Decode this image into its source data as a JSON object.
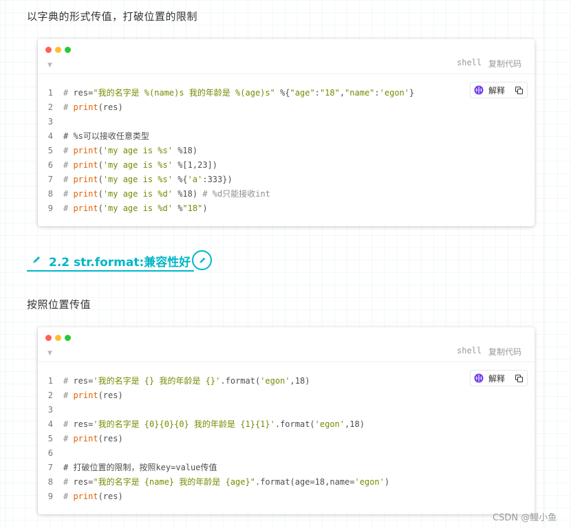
{
  "intro_paragraph": "以字典的形式传值，打破位置的限制",
  "code_blocks": [
    {
      "language": "shell",
      "copy_label": "复制代码",
      "explain_label": "解释",
      "lines": [
        {
          "n": "1",
          "tokens": [
            {
              "t": "c",
              "v": "# "
            },
            {
              "t": "p",
              "v": "res="
            },
            {
              "t": "s",
              "v": "\"我的名字是 %(name)s 我的年龄是 %(age)s\""
            },
            {
              "t": "p",
              "v": " %{"
            },
            {
              "t": "s",
              "v": "\"age\""
            },
            {
              "t": "p",
              "v": ":"
            },
            {
              "t": "s",
              "v": "\"18\""
            },
            {
              "t": "p",
              "v": ","
            },
            {
              "t": "s",
              "v": "\"name\""
            },
            {
              "t": "p",
              "v": ":"
            },
            {
              "t": "s",
              "v": "'egon'"
            },
            {
              "t": "p",
              "v": "}"
            }
          ]
        },
        {
          "n": "2",
          "tokens": [
            {
              "t": "c",
              "v": "# "
            },
            {
              "t": "h",
              "v": "print"
            },
            {
              "t": "p",
              "v": "(res)"
            }
          ]
        },
        {
          "n": "3",
          "tokens": []
        },
        {
          "n": "4",
          "tokens": [
            {
              "t": "t",
              "v": "# %s可以接收任意类型"
            }
          ]
        },
        {
          "n": "5",
          "tokens": [
            {
              "t": "c",
              "v": "# "
            },
            {
              "t": "h",
              "v": "print"
            },
            {
              "t": "p",
              "v": "("
            },
            {
              "t": "s",
              "v": "'my age is %s'"
            },
            {
              "t": "p",
              "v": " %18)"
            }
          ]
        },
        {
          "n": "6",
          "tokens": [
            {
              "t": "c",
              "v": "# "
            },
            {
              "t": "h",
              "v": "print"
            },
            {
              "t": "p",
              "v": "("
            },
            {
              "t": "s",
              "v": "'my age is %s'"
            },
            {
              "t": "p",
              "v": " %[1,23])"
            }
          ]
        },
        {
          "n": "7",
          "tokens": [
            {
              "t": "c",
              "v": "# "
            },
            {
              "t": "h",
              "v": "print"
            },
            {
              "t": "p",
              "v": "("
            },
            {
              "t": "s",
              "v": "'my age is %s'"
            },
            {
              "t": "p",
              "v": " %{"
            },
            {
              "t": "s",
              "v": "'a'"
            },
            {
              "t": "p",
              "v": ":333})"
            }
          ]
        },
        {
          "n": "8",
          "tokens": [
            {
              "t": "c",
              "v": "# "
            },
            {
              "t": "h",
              "v": "print"
            },
            {
              "t": "p",
              "v": "("
            },
            {
              "t": "s",
              "v": "'my age is %d'"
            },
            {
              "t": "p",
              "v": " %18) "
            },
            {
              "t": "c",
              "v": "# %d只能接收int"
            }
          ]
        },
        {
          "n": "9",
          "tokens": [
            {
              "t": "c",
              "v": "# "
            },
            {
              "t": "h",
              "v": "print"
            },
            {
              "t": "p",
              "v": "("
            },
            {
              "t": "s",
              "v": "'my age is %d'"
            },
            {
              "t": "p",
              "v": " %"
            },
            {
              "t": "s",
              "v": "\"18\""
            },
            {
              "t": "p",
              "v": ")"
            }
          ]
        }
      ]
    },
    {
      "language": "shell",
      "copy_label": "复制代码",
      "explain_label": "解释",
      "lines": [
        {
          "n": "1",
          "tokens": [
            {
              "t": "c",
              "v": "# "
            },
            {
              "t": "p",
              "v": "res="
            },
            {
              "t": "s",
              "v": "'我的名字是 {} 我的年龄是 {}'"
            },
            {
              "t": "p",
              "v": ".format("
            },
            {
              "t": "s",
              "v": "'egon'"
            },
            {
              "t": "p",
              "v": ",18)"
            }
          ]
        },
        {
          "n": "2",
          "tokens": [
            {
              "t": "c",
              "v": "# "
            },
            {
              "t": "h",
              "v": "print"
            },
            {
              "t": "p",
              "v": "(res)"
            }
          ]
        },
        {
          "n": "3",
          "tokens": []
        },
        {
          "n": "4",
          "tokens": [
            {
              "t": "c",
              "v": "# "
            },
            {
              "t": "p",
              "v": "res="
            },
            {
              "t": "s",
              "v": "'我的名字是 {0}{0}{0} 我的年龄是 {1}{1}'"
            },
            {
              "t": "p",
              "v": ".format("
            },
            {
              "t": "s",
              "v": "'egon'"
            },
            {
              "t": "p",
              "v": ",18)"
            }
          ]
        },
        {
          "n": "5",
          "tokens": [
            {
              "t": "c",
              "v": "# "
            },
            {
              "t": "h",
              "v": "print"
            },
            {
              "t": "p",
              "v": "(res)"
            }
          ]
        },
        {
          "n": "6",
          "tokens": []
        },
        {
          "n": "7",
          "tokens": [
            {
              "t": "t",
              "v": "# 打破位置的限制，按照key=value传值"
            }
          ]
        },
        {
          "n": "8",
          "tokens": [
            {
              "t": "c",
              "v": "# "
            },
            {
              "t": "p",
              "v": "res="
            },
            {
              "t": "s",
              "v": "\"我的名字是 {name} 我的年龄是 {age}\""
            },
            {
              "t": "p",
              "v": ".format(age=18,name="
            },
            {
              "t": "s",
              "v": "'egon'"
            },
            {
              "t": "p",
              "v": ")"
            }
          ]
        },
        {
          "n": "9",
          "tokens": [
            {
              "t": "c",
              "v": "# "
            },
            {
              "t": "h",
              "v": "print"
            },
            {
              "t": "p",
              "v": "(res)"
            }
          ]
        }
      ]
    }
  ],
  "section_heading": "2.2 str.format:兼容性好",
  "second_paragraph": "按照位置传值",
  "watermark": "CSDN @鳗小鱼",
  "colors": {
    "accent": "#00b5c8",
    "string": "#718c00",
    "keyword": "#e36209",
    "comment": "#8e908c"
  },
  "icons": [
    "collapse-icon",
    "brain-icon",
    "copy-icon",
    "pen-icon",
    "edit-heading-icon"
  ]
}
